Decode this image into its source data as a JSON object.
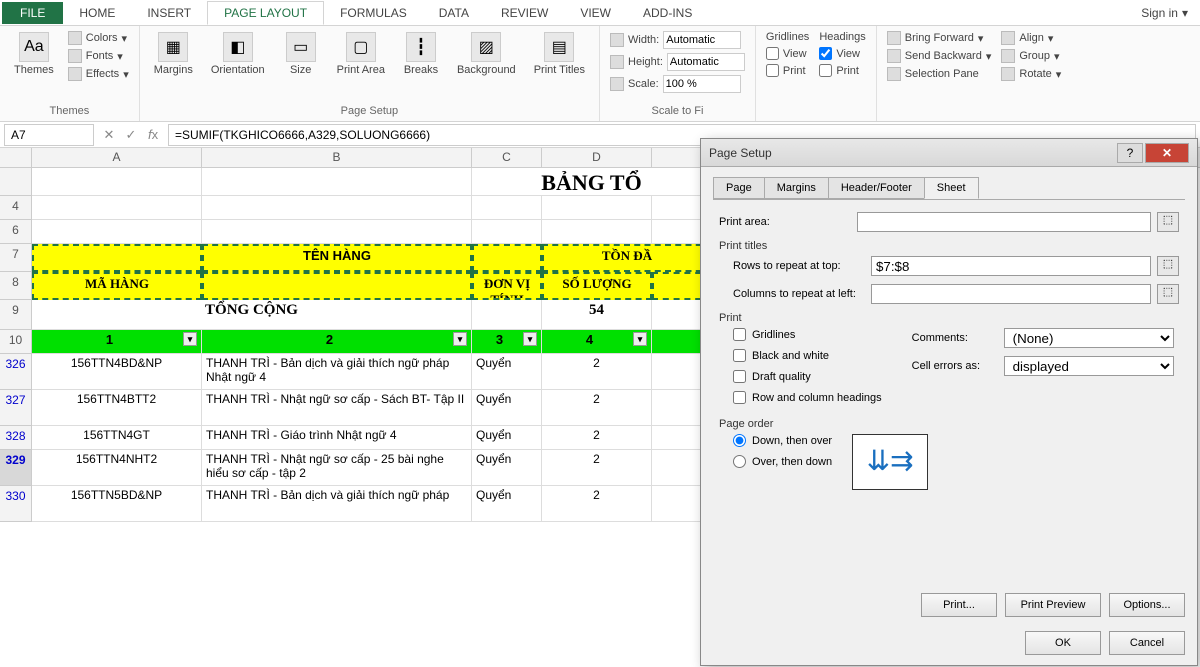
{
  "tabs": {
    "file": "FILE",
    "home": "HOME",
    "insert": "INSERT",
    "pagelayout": "PAGE LAYOUT",
    "formulas": "FORMULAS",
    "data": "DATA",
    "review": "REVIEW",
    "view": "VIEW",
    "addins": "ADD-INS"
  },
  "signin": "Sign in",
  "ribbon": {
    "themes": {
      "themes": "Themes",
      "colors": "Colors",
      "fonts": "Fonts",
      "effects": "Effects",
      "group": "Themes"
    },
    "pagesetup": {
      "margins": "Margins",
      "orientation": "Orientation",
      "size": "Size",
      "printarea": "Print\nArea",
      "breaks": "Breaks",
      "background": "Background",
      "printtitles": "Print\nTitles",
      "group": "Page Setup"
    },
    "scale": {
      "width_l": "Width:",
      "height_l": "Height:",
      "scale_l": "Scale:",
      "auto": "Automatic",
      "scale_v": "100 %",
      "group": "Scale to Fi"
    },
    "sheetopts": {
      "gridlines": "Gridlines",
      "headings": "Headings",
      "view": "View",
      "print": "Print"
    },
    "arrange": {
      "bringfwd": "Bring Forward",
      "sendback": "Send Backward",
      "selpane": "Selection Pane",
      "align": "Align",
      "group": "Group",
      "rotate": "Rotate"
    }
  },
  "fbar": {
    "name": "A7",
    "formula": "=SUMIF(TKGHICO6666,A329,SOLUONG6666)"
  },
  "cols": [
    "A",
    "B",
    "C",
    "D"
  ],
  "sheet": {
    "title": "BẢNG TỔ",
    "h_mahang": "MÃ HÀNG",
    "h_tenhang": "TÊN HÀNG",
    "h_donvi": "ĐƠN VỊ TÍNH",
    "h_tondau": "TỒN ĐẦ",
    "h_soluong": "SỐ LƯỢNG",
    "total_lbl": "TỔNG CỘNG",
    "total_val": "54",
    "nums": [
      "1",
      "2",
      "3",
      "4"
    ],
    "rows": [
      {
        "id": "326",
        "a": "156TTN4BD&NP",
        "b": "THANH TRÌ - Bản dịch và giải thích ngữ pháp Nhật ngữ 4",
        "c": "Quyển",
        "d": "2"
      },
      {
        "id": "327",
        "a": "156TTN4BTT2",
        "b": "THANH TRÌ - Nhật ngữ sơ cấp - Sách BT- Tập II",
        "c": "Quyển",
        "d": "2"
      },
      {
        "id": "328",
        "a": "156TTN4GT",
        "b": "THANH TRÌ - Giáo trình Nhật ngữ 4",
        "c": "Quyển",
        "d": "2"
      },
      {
        "id": "329",
        "a": "156TTN4NHT2",
        "b": "THANH TRÌ - Nhật ngữ sơ cấp - 25 bài nghe hiểu sơ cấp - tập 2",
        "c": "Quyển",
        "d": "2"
      },
      {
        "id": "330",
        "a": "156TTN5BD&NP",
        "b": "THANH TRÌ - Bản dịch và giải thích ngữ pháp",
        "c": "Quyển",
        "d": "2"
      }
    ]
  },
  "dialog": {
    "title": "Page Setup",
    "tabs": {
      "page": "Page",
      "margins": "Margins",
      "headerfooter": "Header/Footer",
      "sheet": "Sheet"
    },
    "printarea_l": "Print area:",
    "printarea_v": "",
    "printtitles": "Print titles",
    "rows_l": "Rows to repeat at top:",
    "rows_v": "$7:$8",
    "cols_l": "Columns to repeat at left:",
    "cols_v": "",
    "print": "Print",
    "gridlines": "Gridlines",
    "bw": "Black and white",
    "draft": "Draft quality",
    "rch": "Row and column headings",
    "comments_l": "Comments:",
    "comments_v": "(None)",
    "errors_l": "Cell errors as:",
    "errors_v": "displayed",
    "pageorder": "Page order",
    "down": "Down, then over",
    "over": "Over, then down",
    "btns": {
      "print": "Print...",
      "preview": "Print Preview",
      "options": "Options...",
      "ok": "OK",
      "cancel": "Cancel"
    }
  }
}
